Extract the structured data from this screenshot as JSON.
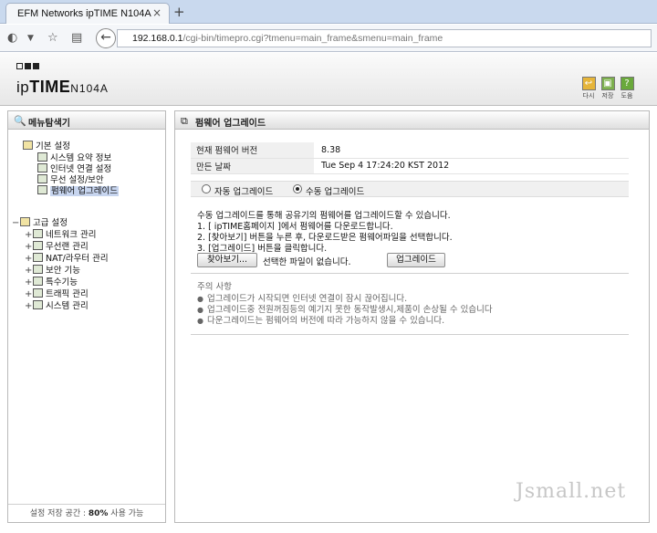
{
  "browser": {
    "tab_title": "EFM Networks ipTIME N104A",
    "tab_close": "×",
    "new_tab": "+",
    "url_host": "192.168.0.1",
    "url_path": "/cgi-bin/timepro.cgi?tmenu=main_frame&smenu=main_frame"
  },
  "header": {
    "logo_prefix": "ip",
    "logo_brand": "TIME",
    "logo_model": "N104A",
    "buttons": [
      {
        "label": "다시",
        "icon": "refresh-icon",
        "color": "#e6b53a"
      },
      {
        "label": "저장",
        "icon": "save-icon",
        "color": "#7db04d"
      },
      {
        "label": "도움",
        "icon": "help-icon",
        "color": "#6aa93b"
      }
    ]
  },
  "sidebar": {
    "title": "메뉴탐색기",
    "basic": {
      "label": "기본 설정",
      "items": [
        "시스템 요약 정보",
        "인터넷 연결 설정",
        "무선 설정/보안",
        "펌웨어 업그레이드"
      ]
    },
    "advanced": {
      "label": "고급 설정",
      "items": [
        "네트워크 관리",
        "무선랜 관리",
        "NAT/라우터 관리",
        "보안 기능",
        "특수기능",
        "트래픽 관리",
        "시스템 관리"
      ]
    },
    "footer_prefix": "설정 저장 공간 :",
    "footer_value": "80%",
    "footer_suffix": "사용 가능"
  },
  "main": {
    "title": "펌웨어 업그레이드",
    "info": [
      {
        "key": "현재 펌웨어 버전",
        "value": "8.38"
      },
      {
        "key": "만든 날짜",
        "value": "Tue Sep 4 17:24:20 KST 2012"
      }
    ],
    "mode_auto": "자동 업그레이드",
    "mode_manual": "수동 업그레이드",
    "instructions": [
      "수동 업그레이드를 통해 공유기의 펌웨어를 업그레이드할 수 있습니다.",
      "1. [ ipTIME홈페이지 ]에서 펌웨어를 다운로드합니다.",
      "2. [찾아보기] 버튼을 누른 후, 다운로드받은 펌웨어파일을 선택합니다.",
      "3. [업그레이드] 버튼을 클릭합니다."
    ],
    "browse_label": "찾아보기...",
    "no_file": "선택한 파일이 없습니다.",
    "upgrade_label": "업그레이드",
    "notes_title": "주의 사항",
    "notes": [
      "업그레이드가 시작되면 인터넷 연결이 잠시 끊어집니다.",
      "업그레이드중 전원꺼짐등의 예기지 못한 동작발생시,제품이 손상될 수 있습니다",
      "다운그레이드는 펌웨어의 버전에 따라 가능하지 않을 수 있습니다."
    ]
  },
  "watermark": "Jsmall.net"
}
